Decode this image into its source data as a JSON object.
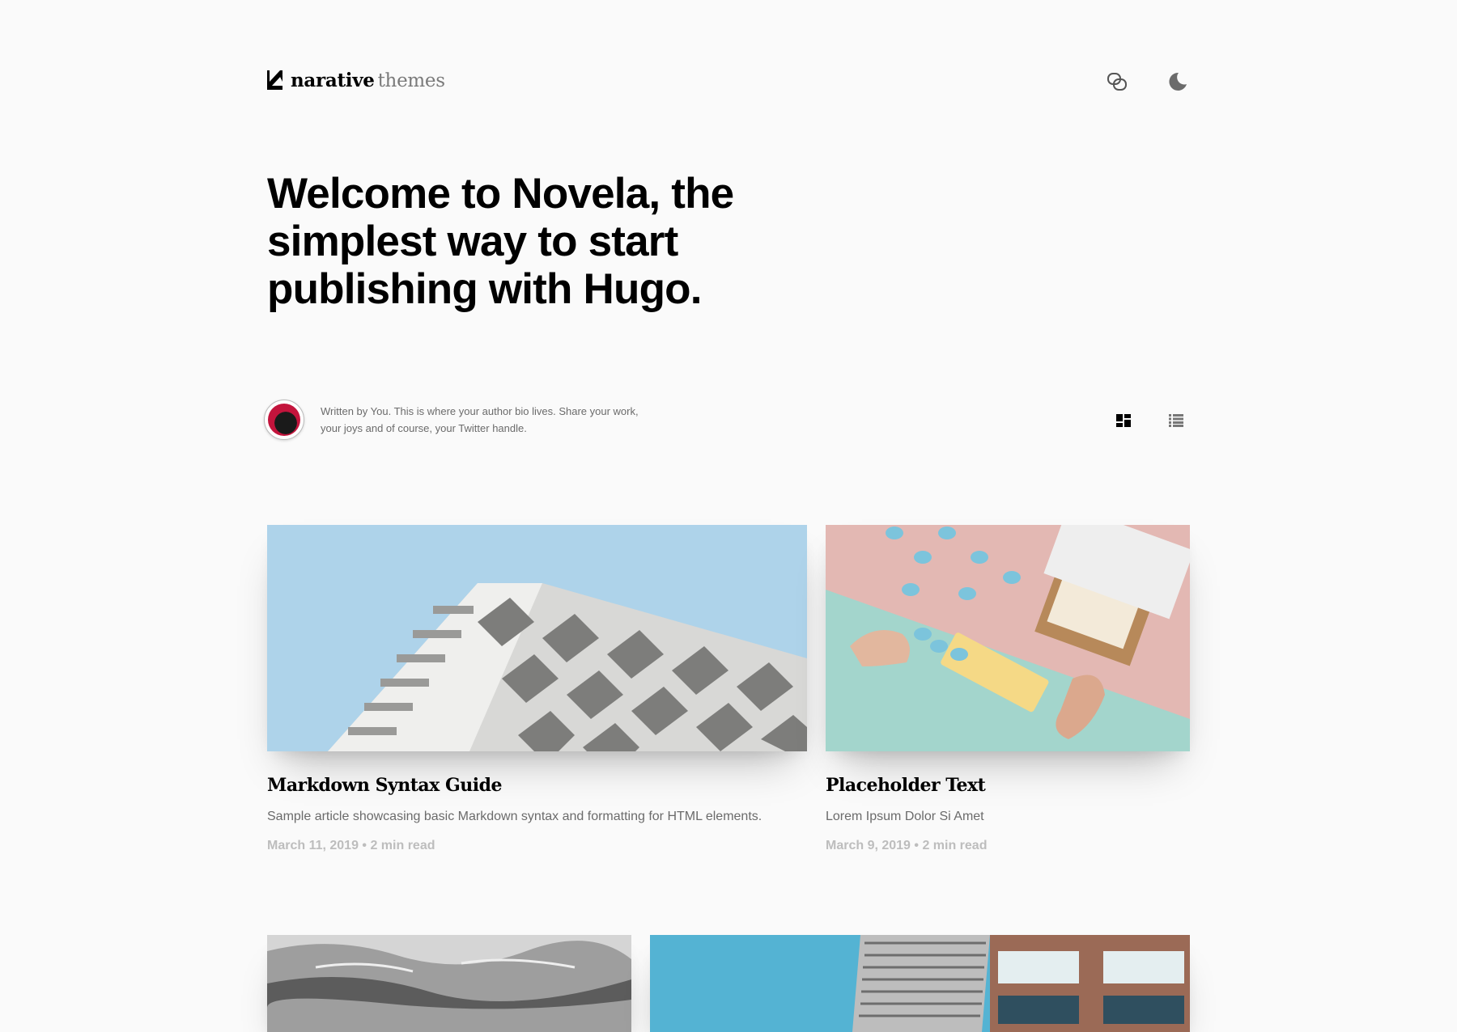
{
  "header": {
    "logo_bold": "narative",
    "logo_light": "themes",
    "copy_icon": "copy-link-icon",
    "theme_icon": "moon-icon"
  },
  "hero": {
    "title": "Welcome to Novela, the simplest way to start publishing with Hugo."
  },
  "author": {
    "bio_line1": "Written by You. This is where your author bio lives. Share your work,",
    "bio_line2": "your joys and of course, your Twitter handle."
  },
  "layout_toggle": {
    "grid_icon": "grid-layout-icon",
    "list_icon": "list-layout-icon"
  },
  "articles": [
    {
      "title": "Markdown Syntax Guide",
      "excerpt": "Sample article showcasing basic Markdown syntax and formatting for HTML elements.",
      "meta": "March 11, 2019 • 2 min read"
    },
    {
      "title": "Placeholder Text",
      "excerpt": "Lorem Ipsum Dolor Si Amet",
      "meta": "March 9, 2019 • 2 min read"
    }
  ],
  "colors": {
    "background": "#fafafa",
    "text_primary": "#000000",
    "text_secondary": "#6b6b6b",
    "text_muted": "#bdbdbd"
  }
}
